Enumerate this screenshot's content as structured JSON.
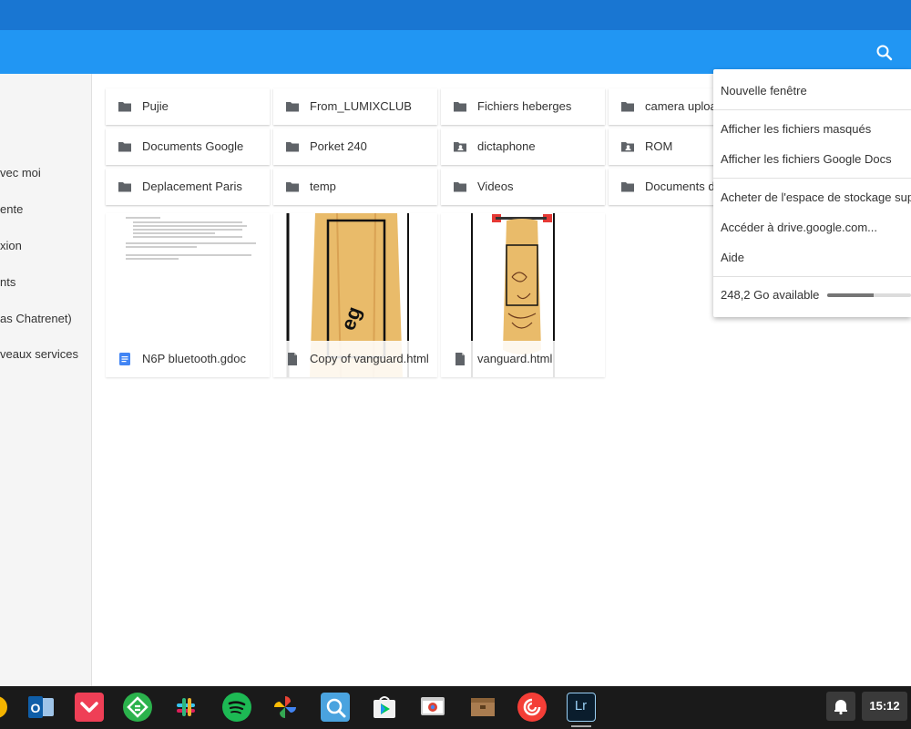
{
  "sidebar": {
    "items": [
      {
        "label": "vec moi"
      },
      {
        "label": "ente"
      },
      {
        "label": "xion"
      },
      {
        "label": "nts"
      },
      {
        "label": "as Chatrenet)"
      },
      {
        "label": "veaux services"
      }
    ]
  },
  "folders": [
    {
      "name": "Pujie",
      "icon": "folder-icon"
    },
    {
      "name": "From_LUMIXCLUB",
      "icon": "folder-icon"
    },
    {
      "name": "Fichiers heberges",
      "icon": "folder-icon"
    },
    {
      "name": "camera uploads",
      "icon": "folder-icon"
    },
    {
      "name": "Documents Google",
      "icon": "folder-icon"
    },
    {
      "name": "Porket 240",
      "icon": "folder-icon"
    },
    {
      "name": "dictaphone",
      "icon": "shared-folder-icon"
    },
    {
      "name": "ROM",
      "icon": "shared-folder-icon"
    },
    {
      "name": "Deplacement Paris",
      "icon": "folder-icon"
    },
    {
      "name": "temp",
      "icon": "folder-icon"
    },
    {
      "name": "Videos",
      "icon": "folder-icon"
    },
    {
      "name": "Documents d",
      "icon": "folder-icon"
    }
  ],
  "files": [
    {
      "name": "N6P bluetooth.gdoc",
      "icon": "google-doc-icon"
    },
    {
      "name": "Copy of vanguard.html",
      "icon": "file-icon"
    },
    {
      "name": "vanguard.html",
      "icon": "file-icon"
    }
  ],
  "menu": {
    "new_window": "Nouvelle fenêtre",
    "show_hidden": "Afficher les fichiers masqués",
    "show_gdocs": "Afficher les fichiers Google Docs",
    "buy_storage": "Acheter de l'espace de stockage supp",
    "open_drive": "Accéder à drive.google.com...",
    "help": "Aide",
    "storage_available": "248,2 Go available",
    "storage_used_fraction": 0.55
  },
  "shelf": {
    "apps": [
      "outlook-icon",
      "pocket-icon",
      "feedly-icon",
      "slack-icon",
      "spotify-icon",
      "google-photos-icon",
      "screenshot-tool-icon",
      "play-store-icon",
      "chrome-web-store-icon",
      "archive-icon",
      "pocketcasts-icon",
      "lightroom-icon"
    ],
    "lightroom_label": "Lr",
    "outlook_label": "O",
    "time": "15:12"
  },
  "colors": {
    "titlebar": "#1976d2",
    "toolbar": "#2196f3",
    "shelf": "#1a1a1a"
  }
}
